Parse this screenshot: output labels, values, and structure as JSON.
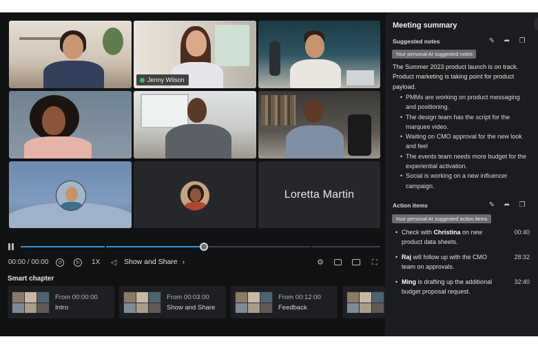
{
  "participants": {
    "jenny_label": "Jenny Wilson",
    "loretta_label": "Loretta Martin"
  },
  "player": {
    "time": "00:00 / 00:00",
    "speed": "1X",
    "chapter_link": "Show and Share",
    "progress": 0.51
  },
  "smart_chapter": {
    "title": "Smart chapter",
    "items": [
      {
        "from": "From 00:00:00",
        "label": "Intro"
      },
      {
        "from": "From 00:03:00",
        "label": "Show and Share"
      },
      {
        "from": "From 00:12:00",
        "label": "Feedback"
      }
    ]
  },
  "summary_panel": {
    "title": "Meeting summary",
    "notes_heading": "Suggested notes",
    "notes_badge": "Your personal AI suggested notes",
    "summary_text": "The Summer 2023 product launch is on track. Product marketing is taking point for product payload.",
    "bullets": [
      "PMMs are working on product messaging and positioning.",
      "The design team has the script for the marquee video.",
      "Waiting on CMO approval for the new look and feel",
      "The events team needs more budget for the experiential activation.",
      "Social is working on a new influencer campaign."
    ],
    "actions_heading": "Action items",
    "actions_badge": "Your personal AI suggested action items",
    "actions": [
      {
        "pre": "Check with ",
        "name": "Christina",
        "post": " on new product data sheets.",
        "time": "00:40"
      },
      {
        "pre": "",
        "name": "Raj",
        "post": " will follow up with the CMO team on approvals.",
        "time": "28:32"
      },
      {
        "pre": "",
        "name": "Ming",
        "post": " is drafting up the additional budget proposal request.",
        "time": "32:40"
      }
    ]
  },
  "colors": {
    "accent": "#20c7a6",
    "progress": "#2b97d9",
    "background": "#111214",
    "panel": "#1b1c1f"
  }
}
